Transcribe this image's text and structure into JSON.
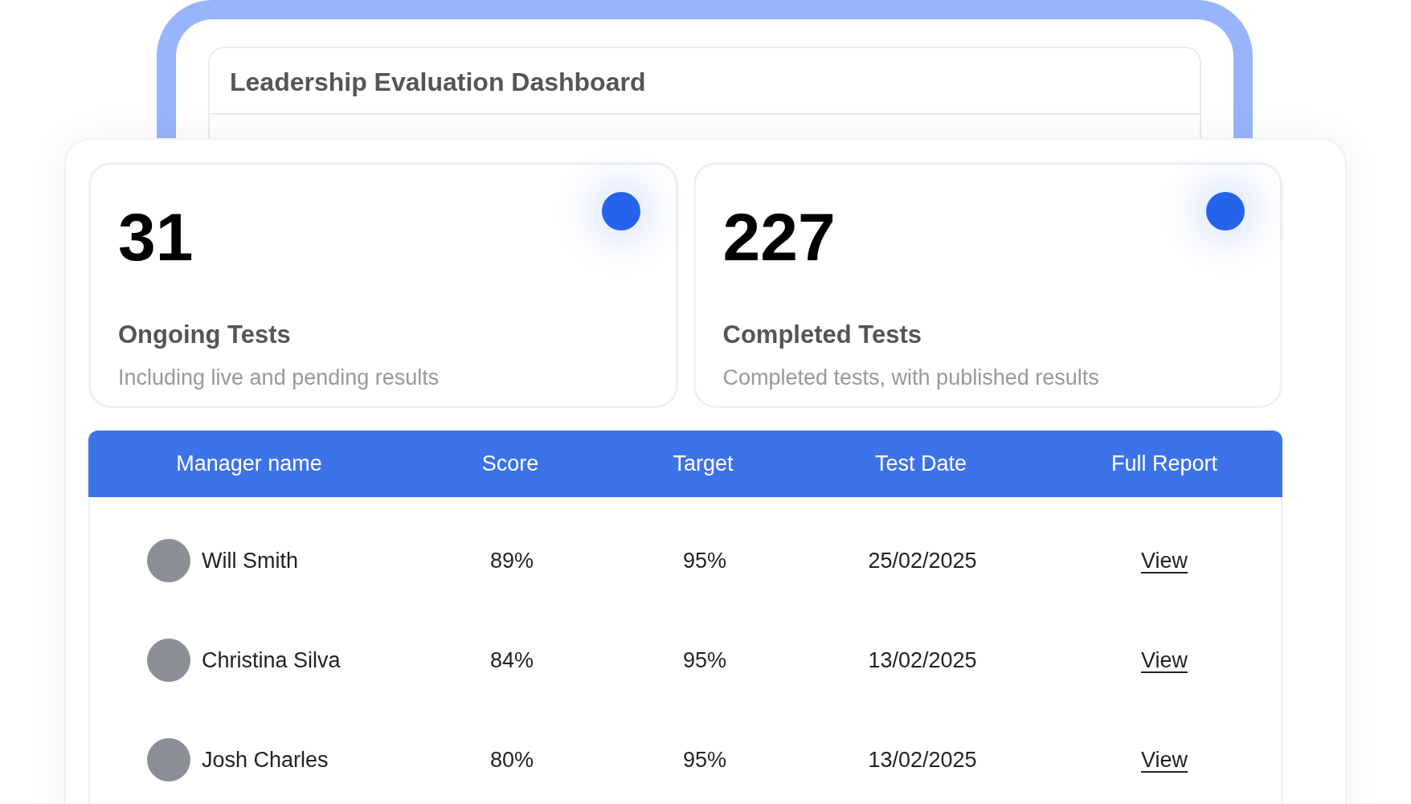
{
  "dashboard": {
    "title": "Leadership Evaluation Dashboard"
  },
  "stats": [
    {
      "value": "31",
      "label": "Ongoing Tests",
      "description": "Including live and pending results"
    },
    {
      "value": "227",
      "label": "Completed Tests",
      "description": "Completed tests, with published results"
    }
  ],
  "table": {
    "columns": [
      "Manager name",
      "Score",
      "Target",
      "Test Date",
      "Full Report"
    ],
    "rows": [
      {
        "name": "Will Smith",
        "score": "89%",
        "target": "95%",
        "date": "25/02/2025",
        "report": "View"
      },
      {
        "name": "Christina Silva",
        "score": "84%",
        "target": "95%",
        "date": "13/02/2025",
        "report": "View"
      },
      {
        "name": "Josh Charles",
        "score": "80%",
        "target": "95%",
        "date": "13/02/2025",
        "report": "View"
      }
    ]
  }
}
